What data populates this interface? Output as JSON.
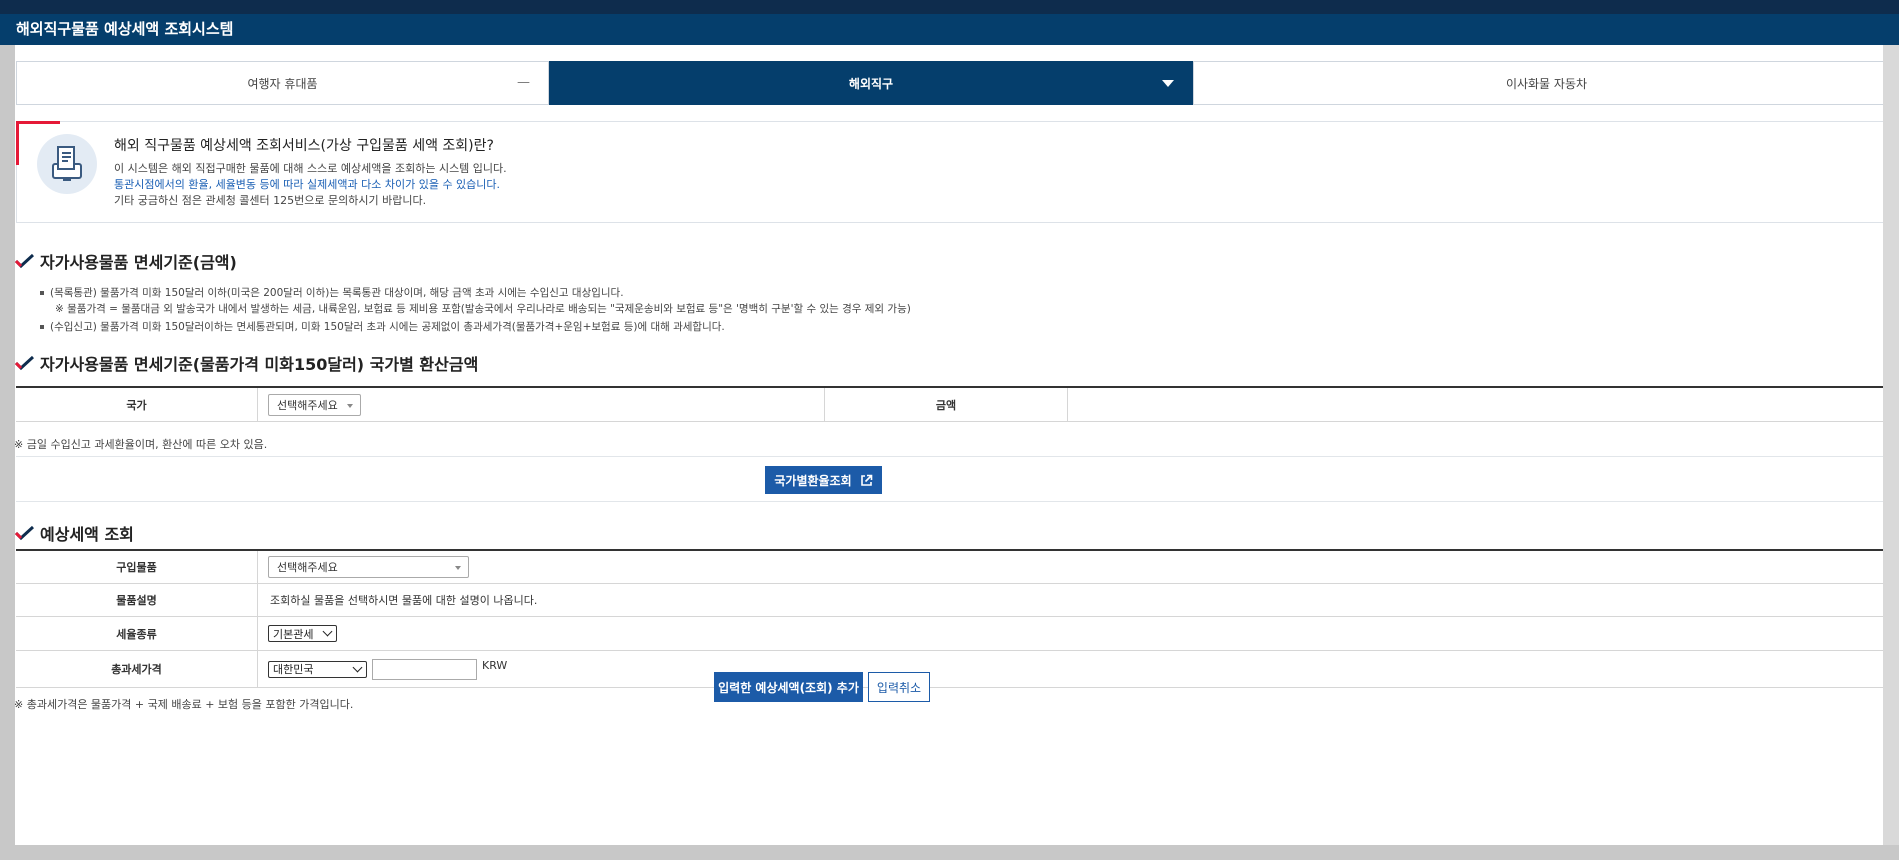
{
  "app": {
    "title": "해외직구물품 예상세액 조회시스템"
  },
  "tabs": [
    {
      "label": "여행자 휴대품"
    },
    {
      "label": "해외직구"
    },
    {
      "label": "이사화물 자동차"
    }
  ],
  "info": {
    "title": "해외 직구물품 예상세액 조회서비스(가상 구입물품 세액 조회)란?",
    "line1": "이 시스템은 해외 직접구매한 물품에 대해 스스로 예상세액을 조회하는 시스템 입니다.",
    "line2": "통관시점에서의 환율, 세율변동 등에 따라 실제세액과 다소 차이가 있을 수 있습니다.",
    "line3": "기타 궁금하신 점은 관세청 콜센터 125번으로 문의하시기 바랍니다."
  },
  "section1": {
    "title": "자가사용물품 면세기준(금액)",
    "bullet1": "(목록통관) 물품가격 미화 150달러 이하(미국은 200달러 이하)는 목록통관 대상이며, 해당 금액 초과 시에는 수입신고 대상입니다.",
    "bullet1_sub": "※ 물품가격 = 물품대금 외 발송국가 내에서 발생하는 세금, 내륙운임, 보험료 등 제비용 포함(발송국에서 우리나라로 배송되는 \"국제운송비와 보험료 등\"은 '명백히 구분'할 수 있는 경우 제외 가능)",
    "bullet2": "(수입신고) 물품가격 미화 150달러이하는 면세통관되며, 미화 150달러 초과 시에는 공제없이 총과세가격(물품가격+운임+보험료 등)에 대해 과세합니다."
  },
  "section2": {
    "title": "자가사용물품 면세기준(물품가격 미화150달러) 국가별 환산금액",
    "country_label": "국가",
    "country_select": "선택해주세요",
    "amount_label": "금액",
    "note": "※ 금일 수입신고 과세환율이며, 환산에 따른 오차 있음.",
    "exchange_button": "국가별환율조회"
  },
  "section3": {
    "title": "예상세액 조회",
    "item_label": "구입물품",
    "item_select": "선택해주세요",
    "desc_label": "물품설명",
    "desc_text": "조회하실 물품을 선택하시면 물품에 대한 설명이 나옵니다.",
    "taxtype_label": "세율종류",
    "taxtype_value": "기본관세",
    "total_label": "총과세가격",
    "currency_value": "대한민국",
    "currency_unit": "KRW",
    "note": "※ 총과세가격은 물품가격 + 국제 배송료 + 보험 등을 포함한 가격입니다.",
    "add_button": "입력한 예상세액(조회) 추가",
    "cancel_button": "입력취소"
  },
  "colors": {
    "navy": "#053e6c",
    "button_blue": "#1c5ba8",
    "accent_red": "#e51937"
  }
}
